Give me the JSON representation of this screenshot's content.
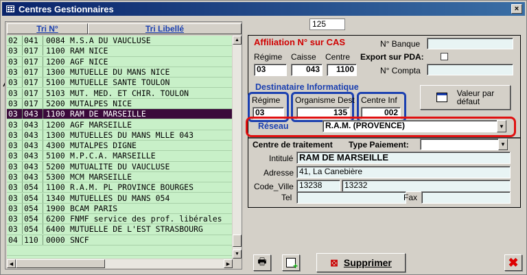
{
  "window": {
    "title": "Centres Gestionnaires",
    "close_label": "×"
  },
  "list": {
    "col_sort_num": "Tri N°",
    "col_sort_label": "Tri Libellé",
    "rows": [
      {
        "a": "02",
        "b": "041",
        "c": "0084",
        "d": "M.S.A DU VAUCLUSE"
      },
      {
        "a": "03",
        "b": "017",
        "c": "1100",
        "d": "RAM NICE"
      },
      {
        "a": "03",
        "b": "017",
        "c": "1200",
        "d": "AGF NICE"
      },
      {
        "a": "03",
        "b": "017",
        "c": "1300",
        "d": "MUTUELLE DU MANS NICE"
      },
      {
        "a": "03",
        "b": "017",
        "c": "5100",
        "d": "MUTUELLE SANTE TOULON"
      },
      {
        "a": "03",
        "b": "017",
        "c": "5103",
        "d": "MUT. MED. ET CHIR. TOULON"
      },
      {
        "a": "03",
        "b": "017",
        "c": "5200",
        "d": "MUTALPES NICE"
      },
      {
        "a": "03",
        "b": "043",
        "c": "1100",
        "d": "RAM DE MARSEILLE",
        "selected": true
      },
      {
        "a": "03",
        "b": "043",
        "c": "1200",
        "d": "AGF MARSEILLE"
      },
      {
        "a": "03",
        "b": "043",
        "c": "1300",
        "d": "MUTUELLES DU MANS MLLE 043"
      },
      {
        "a": "03",
        "b": "043",
        "c": "4300",
        "d": "MUTALPES DIGNE"
      },
      {
        "a": "03",
        "b": "043",
        "c": "5100",
        "d": "M.P.C.A. MARSEILLE"
      },
      {
        "a": "03",
        "b": "043",
        "c": "5200",
        "d": "MUTUALITE DU VAUCLUSE"
      },
      {
        "a": "03",
        "b": "043",
        "c": "5300",
        "d": "MCM MARSEILLE"
      },
      {
        "a": "03",
        "b": "054",
        "c": "1100",
        "d": "R.A.M.  PL PROVINCE BOURGES"
      },
      {
        "a": "03",
        "b": "054",
        "c": "1340",
        "d": "MUTUELLES DU MANS 054"
      },
      {
        "a": "03",
        "b": "054",
        "c": "1900",
        "d": "BCAM PARIS"
      },
      {
        "a": "03",
        "b": "054",
        "c": "6200",
        "d": "FNMF  service des prof. libérales"
      },
      {
        "a": "03",
        "b": "054",
        "c": "6400",
        "d": "MUTUELLE DE L'EST STRASBOURG"
      },
      {
        "a": "04",
        "b": "110",
        "c": "0000",
        "d": "SNCF"
      },
      {
        "a": "",
        "b": "",
        "c": "",
        "d": ""
      }
    ]
  },
  "record_number": "125",
  "affiliation": {
    "title": "Affiliation N° sur CAS",
    "banque_label": "N° Banque",
    "banque_value": "",
    "regime_label": "Régime",
    "caisse_label": "Caisse",
    "centre_label": "Centre",
    "export_label": "Export sur PDA:",
    "compta_label": "N° Compta",
    "compta_value": "",
    "regime_value": "03",
    "caisse_value": "043",
    "centre_value": "1100"
  },
  "destinataire": {
    "title": "Destinataire Informatique",
    "regime_label": "Régime",
    "organisme_label": "Organisme Dest",
    "centre_inf_label": "Centre Inf",
    "regime_value": "03",
    "organisme_value": "135",
    "centre_inf_value": "002",
    "default_button": "Valeur par\ndéfaut"
  },
  "reseau": {
    "label": "Réseau",
    "value": "R.A.M. (PROVENCE)"
  },
  "traitement": {
    "title": "Centre de traitement",
    "type_paiement_label": "Type Paiement:",
    "type_paiement_value": "",
    "intitule_label": "Intitulé",
    "intitule_value": "RAM DE MARSEILLE",
    "adresse_label": "Adresse",
    "adresse_value": "41, La Canebière",
    "code_ville_label": "Code_Ville",
    "code_value": "13238",
    "ville_value": "13232",
    "tel_label": "Tel",
    "tel_value": "",
    "fax_label": "Fax",
    "fax_value": ""
  },
  "toolbar": {
    "print_icon": "printer-icon",
    "new_icon": "new-record-icon",
    "delete_label": "Supprimer",
    "close_icon": "close-icon"
  },
  "colors": {
    "accent_red": "#e01010",
    "accent_blue": "#1a3fb0",
    "list_bg": "#c8f0c8",
    "selected_bg": "#3a0a3a"
  }
}
